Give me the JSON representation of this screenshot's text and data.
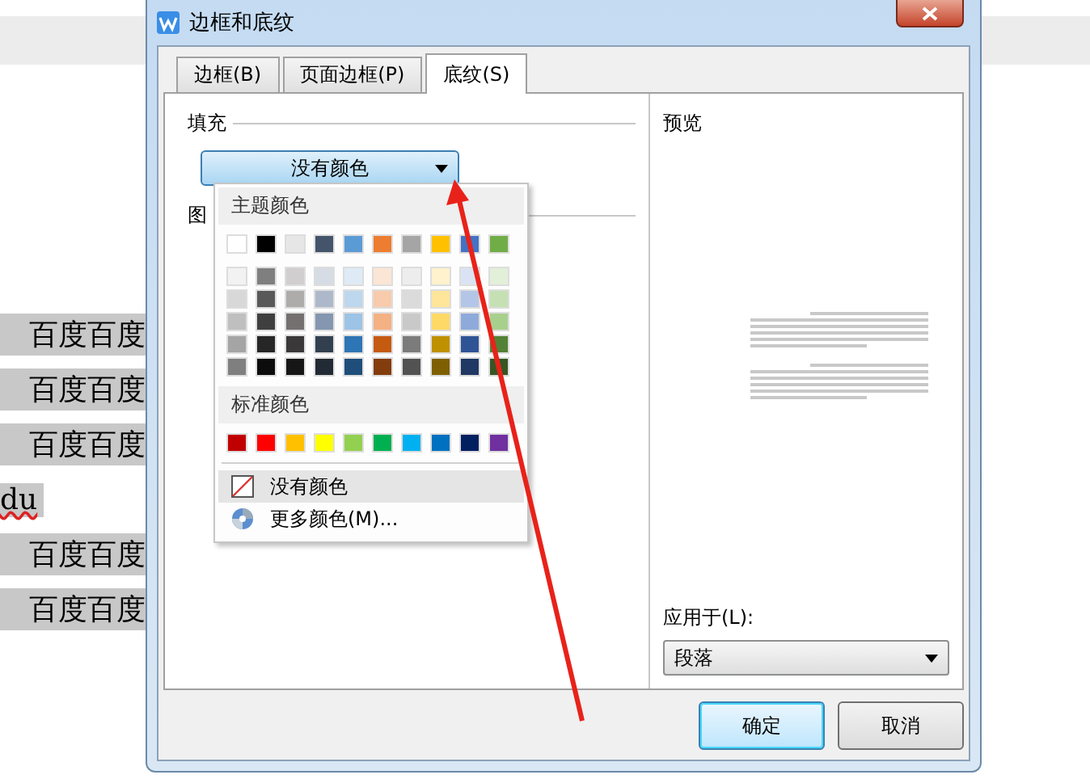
{
  "document": {
    "lines": [
      {
        "text": "百度百度",
        "highlighted": true,
        "misspelled": false
      },
      {
        "text": "百度百度",
        "highlighted": true,
        "misspelled": false
      },
      {
        "text": "百度百度",
        "highlighted": true,
        "misspelled": false
      },
      {
        "text": "du",
        "highlighted": false,
        "misspelled": true
      },
      {
        "text": "百度百度",
        "highlighted": true,
        "misspelled": false
      },
      {
        "text": "百度百度",
        "highlighted": true,
        "misspelled": false
      }
    ]
  },
  "window": {
    "title": "边框和底纹"
  },
  "tabs": [
    {
      "label": "边框(B)",
      "selected": false
    },
    {
      "label": "页面边框(P)",
      "selected": false
    },
    {
      "label": "底纹(S)",
      "selected": true
    }
  ],
  "fill": {
    "label": "填充",
    "dropdown": {
      "value": "没有颜色"
    }
  },
  "pattern": {
    "label": "图"
  },
  "color_menu": {
    "theme_heading": "主题颜色",
    "theme_colors": [
      {
        "color": "#ffffff"
      },
      {
        "color": "#000000"
      },
      {
        "color": "#e7e6e6"
      },
      {
        "color": "#44546a"
      },
      {
        "color": "#5b9bd5"
      },
      {
        "color": "#ed7d31"
      },
      {
        "color": "#a5a5a5"
      },
      {
        "color": "#ffc000"
      },
      {
        "color": "#4472c4"
      },
      {
        "color": "#70ad47"
      }
    ],
    "shades": [
      [
        {
          "color": "#f2f2f2"
        },
        {
          "color": "#7f7f7f"
        },
        {
          "color": "#d0cece"
        },
        {
          "color": "#d6dce4"
        },
        {
          "color": "#deebf6"
        },
        {
          "color": "#fbe5d5"
        },
        {
          "color": "#ededed"
        },
        {
          "color": "#fff2cc"
        },
        {
          "color": "#dae3f3"
        },
        {
          "color": "#e2efd9"
        }
      ],
      [
        {
          "color": "#d8d8d8"
        },
        {
          "color": "#595959"
        },
        {
          "color": "#aeabab"
        },
        {
          "color": "#adb9ca"
        },
        {
          "color": "#bdd7ee"
        },
        {
          "color": "#f7cbac"
        },
        {
          "color": "#dbdbdb"
        },
        {
          "color": "#fee599"
        },
        {
          "color": "#b4c6e7"
        },
        {
          "color": "#c5e0b3"
        }
      ],
      [
        {
          "color": "#bfbfbf"
        },
        {
          "color": "#3f3f3f"
        },
        {
          "color": "#757070"
        },
        {
          "color": "#8496b0"
        },
        {
          "color": "#9dc3e6"
        },
        {
          "color": "#f4b183"
        },
        {
          "color": "#c9c9c9"
        },
        {
          "color": "#ffd965"
        },
        {
          "color": "#8eaadb"
        },
        {
          "color": "#a8d08d"
        }
      ],
      [
        {
          "color": "#a5a5a5"
        },
        {
          "color": "#262626"
        },
        {
          "color": "#3a3838"
        },
        {
          "color": "#323f4f"
        },
        {
          "color": "#2e75b5"
        },
        {
          "color": "#c55a11"
        },
        {
          "color": "#7b7b7b"
        },
        {
          "color": "#bf9000"
        },
        {
          "color": "#2f5496"
        },
        {
          "color": "#538135"
        }
      ],
      [
        {
          "color": "#7f7f7f"
        },
        {
          "color": "#0c0c0c"
        },
        {
          "color": "#171616"
        },
        {
          "color": "#222a35"
        },
        {
          "color": "#1e4e79"
        },
        {
          "color": "#833c0b"
        },
        {
          "color": "#525252"
        },
        {
          "color": "#7f6000"
        },
        {
          "color": "#1f3864"
        },
        {
          "color": "#375623"
        }
      ]
    ],
    "standard_heading": "标准颜色",
    "standard_colors": [
      {
        "color": "#c00000"
      },
      {
        "color": "#ff0000"
      },
      {
        "color": "#ffc000"
      },
      {
        "color": "#ffff00"
      },
      {
        "color": "#92d050"
      },
      {
        "color": "#00b050"
      },
      {
        "color": "#00b0f0"
      },
      {
        "color": "#0070c0"
      },
      {
        "color": "#002060"
      },
      {
        "color": "#7030a0"
      }
    ],
    "items": [
      {
        "kind": "none",
        "label": "没有颜色",
        "selected": true
      },
      {
        "kind": "more",
        "label": "更多颜色(M)...",
        "selected": false
      }
    ]
  },
  "preview": {
    "label": "预览"
  },
  "apply_to": {
    "label": "应用于(L):",
    "value": "段落"
  },
  "buttons": [
    {
      "label": "确定",
      "default": true
    },
    {
      "label": "取消",
      "default": false
    }
  ]
}
